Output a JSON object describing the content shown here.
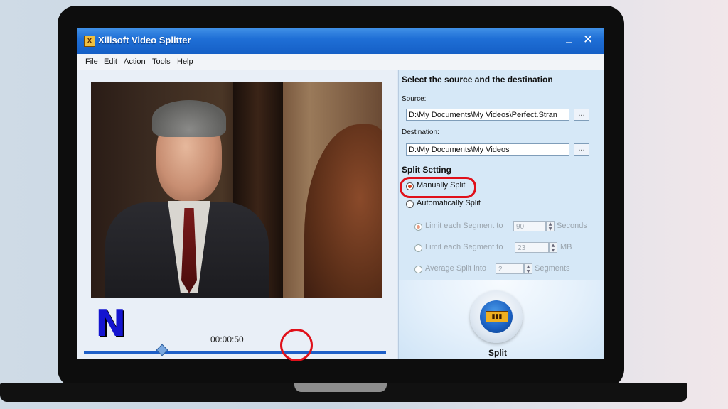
{
  "window": {
    "title": "Xilisoft Video Splitter",
    "minimize": "_",
    "close": "✕"
  },
  "menu": [
    "File",
    "Edit",
    "Action",
    "Tools",
    "Help"
  ],
  "player": {
    "time": "00:00:50"
  },
  "overlay": {
    "logo_letter": "N"
  },
  "panel": {
    "heading": "Select the source and the destination",
    "source_label": "Source:",
    "source_value": "D:\\My Documents\\My Videos\\Perfect.Stran",
    "destination_label": "Destination:",
    "destination_value": "D:\\My Documents\\My Videos",
    "browse": "...",
    "split_setting": "Split Setting",
    "manual": "Manually Split",
    "auto": "Automatically Split",
    "seg_seconds_label": "Limit each Segment to",
    "seg_seconds_value": "90",
    "seg_seconds_unit": "Seconds",
    "seg_mb_label": "Limit each Segment to",
    "seg_mb_value": "23",
    "seg_mb_unit": "MB",
    "avg_label": "Average Split into",
    "avg_value": "2",
    "avg_unit": "Segments",
    "split_button": "Split"
  },
  "state": {
    "mode": "manual",
    "auto_submode": "seconds"
  },
  "colors": {
    "highlight": "#e0101a",
    "titlebar": "#1f6fd6"
  }
}
